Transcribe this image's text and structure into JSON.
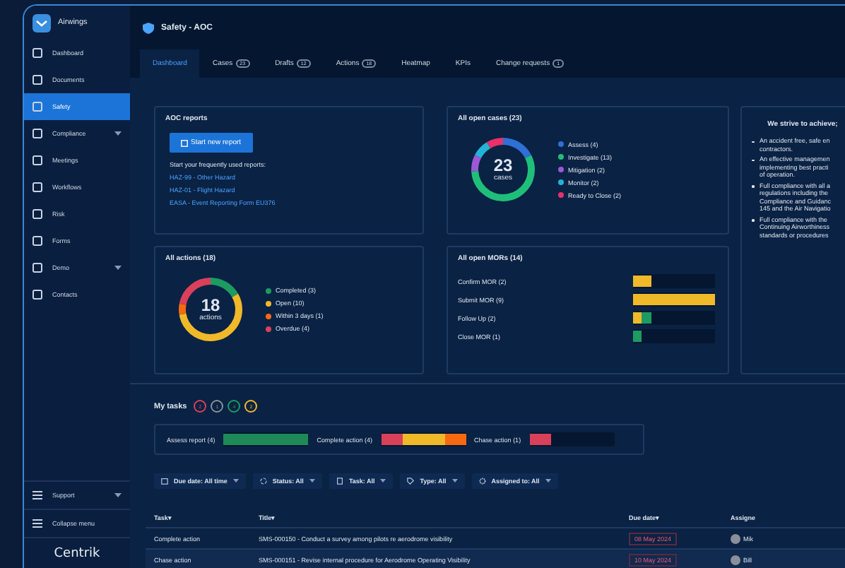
{
  "app": {
    "name": "Airwings",
    "page_title": "Safety - AOC",
    "footer_logo": "Centrik"
  },
  "sidebar": {
    "items": [
      {
        "label": "Dashboard",
        "selected": false,
        "expandable": false
      },
      {
        "label": "Documents",
        "selected": false,
        "expandable": false
      },
      {
        "label": "Safety",
        "selected": true,
        "expandable": false
      },
      {
        "label": "Compliance",
        "selected": false,
        "expandable": true
      },
      {
        "label": "Meetings",
        "selected": false,
        "expandable": false
      },
      {
        "label": "Workflows",
        "selected": false,
        "expandable": false
      },
      {
        "label": "Risk",
        "selected": false,
        "expandable": false
      },
      {
        "label": "Forms",
        "selected": false,
        "expandable": false
      },
      {
        "label": "Demo",
        "selected": false,
        "expandable": true
      },
      {
        "label": "Contacts",
        "selected": false,
        "expandable": false
      }
    ],
    "bottom": [
      {
        "label": "Support",
        "expandable": true
      },
      {
        "label": "Collapse menu",
        "expandable": false
      }
    ]
  },
  "tabs": [
    {
      "label": "Dashboard",
      "selected": true
    },
    {
      "label": "Cases",
      "count": "23",
      "selected": false
    },
    {
      "label": "Drafts",
      "count": "12",
      "selected": false
    },
    {
      "label": "Actions",
      "count": "18",
      "selected": false
    },
    {
      "label": "Heatmap",
      "selected": false
    },
    {
      "label": "KPIs",
      "selected": false
    },
    {
      "label": "Change requests",
      "count": "1",
      "selected": false
    }
  ],
  "aoc_reports": {
    "title": "AOC reports",
    "button": "Start new report",
    "subtitle": "Start your frequently used reports:",
    "links": [
      "HAZ-99 - Other Hazard",
      "HAZ-01 - Flight Hazard",
      "EASA - Event Reporting Form EU376"
    ]
  },
  "open_cases": {
    "title": "All open cases (23)",
    "total": "23",
    "unit": "cases",
    "legend": [
      {
        "label": "Assess (4)",
        "color": "#2f6fd6",
        "level": 0.174
      },
      {
        "label": "Investigate (13)",
        "color": "#1fbf7a",
        "level": 0.565
      },
      {
        "label": "Mitigation (2)",
        "color": "#9b59d6",
        "level": 0.087
      },
      {
        "label": "Monitor (2)",
        "color": "#22b4d8",
        "level": 0.087
      },
      {
        "label": "Ready to Close (2)",
        "color": "#e8306a",
        "level": 0.087
      }
    ]
  },
  "all_actions": {
    "title": "All actions (18)",
    "total": "18",
    "unit": "actions",
    "legend": [
      {
        "label": "Completed (3)",
        "color": "#1d9b62",
        "level": 0.167
      },
      {
        "label": "Open (10)",
        "color": "#f0b92a",
        "level": 0.555
      },
      {
        "label": "Within 3 days (1)",
        "color": "#f56a10",
        "level": 0.056
      },
      {
        "label": "Overdue (4)",
        "color": "#d9405a",
        "level": 0.222
      }
    ]
  },
  "open_mors": {
    "title": "All open MORs (14)",
    "rows": [
      {
        "label": "Confirm MOR (2)",
        "segments": [
          {
            "color": "#f0b92a",
            "level": 0.22
          }
        ]
      },
      {
        "label": "Submit MOR (9)",
        "segments": [
          {
            "color": "#f0b92a",
            "level": 1
          }
        ]
      },
      {
        "label": "Follow Up (2)",
        "segments": [
          {
            "color": "#f0b92a",
            "level": 0.11
          },
          {
            "color": "#1d9b62",
            "level": 0.22
          }
        ]
      },
      {
        "label": "Close MOR (1)",
        "segments": [
          {
            "color": "#1d9b62",
            "level": 0.11
          }
        ]
      }
    ]
  },
  "strive": {
    "title": "We strive to achieve;",
    "bullets": [
      [
        "An accident free, safe en",
        "contractors."
      ],
      [
        "An effective managemen",
        "implementing best practi",
        "of operation."
      ],
      [
        "Full compliance with all a",
        "regulations including the",
        "Compliance and Guidanc",
        "145 and the Air Navigatio"
      ],
      [
        "Full compliance with the",
        "Continuing Airworthiness",
        "standards or procedures"
      ]
    ]
  },
  "my_tasks": {
    "title": "My tasks",
    "badges": [
      {
        "text": "2",
        "color": "#d9405a"
      },
      {
        "text": "1",
        "color": "#8a8f99"
      },
      {
        "text": "4",
        "color": "#1d9b62"
      },
      {
        "text": "2",
        "color": "#f0b92a"
      }
    ],
    "groups": [
      {
        "label": "Assess report (4)",
        "segments": [
          {
            "color": "#1d8a58",
            "level": 1
          }
        ]
      },
      {
        "label": "Complete action (4)",
        "segments": [
          {
            "color": "#d9405a",
            "level": 0.25
          },
          {
            "color": "#f0b92a",
            "level": 0.75
          },
          {
            "color": "#f56a10",
            "level": 1
          }
        ]
      },
      {
        "label": "Chase action (1)",
        "segments": [
          {
            "color": "#d9405a",
            "level": 0.25
          }
        ]
      }
    ]
  },
  "filters": [
    {
      "label": "Due date: All time"
    },
    {
      "label": "Status: All"
    },
    {
      "label": "Task: All"
    },
    {
      "label": "Type: All"
    },
    {
      "label": "Assigned to: All"
    }
  ],
  "table": {
    "columns": [
      {
        "label": "Task",
        "sort": "▾"
      },
      {
        "label": "Title",
        "sort": "▾"
      },
      {
        "label": "Due date",
        "sort": "▾"
      },
      {
        "label": "Assigne"
      }
    ],
    "rows": [
      {
        "task": "Complete action",
        "title": "SMS-000150 - Conduct a survey among pilots re aerodrome visibility",
        "due": "08 May 2024",
        "assignee": "Mik",
        "selected": false
      },
      {
        "task": "Chase action",
        "title": "SMS-000151 - Revise internal procedure for Aerodrome Operating Visibility",
        "due": "10 May 2024",
        "assignee": "Bill",
        "selected": true
      }
    ]
  }
}
